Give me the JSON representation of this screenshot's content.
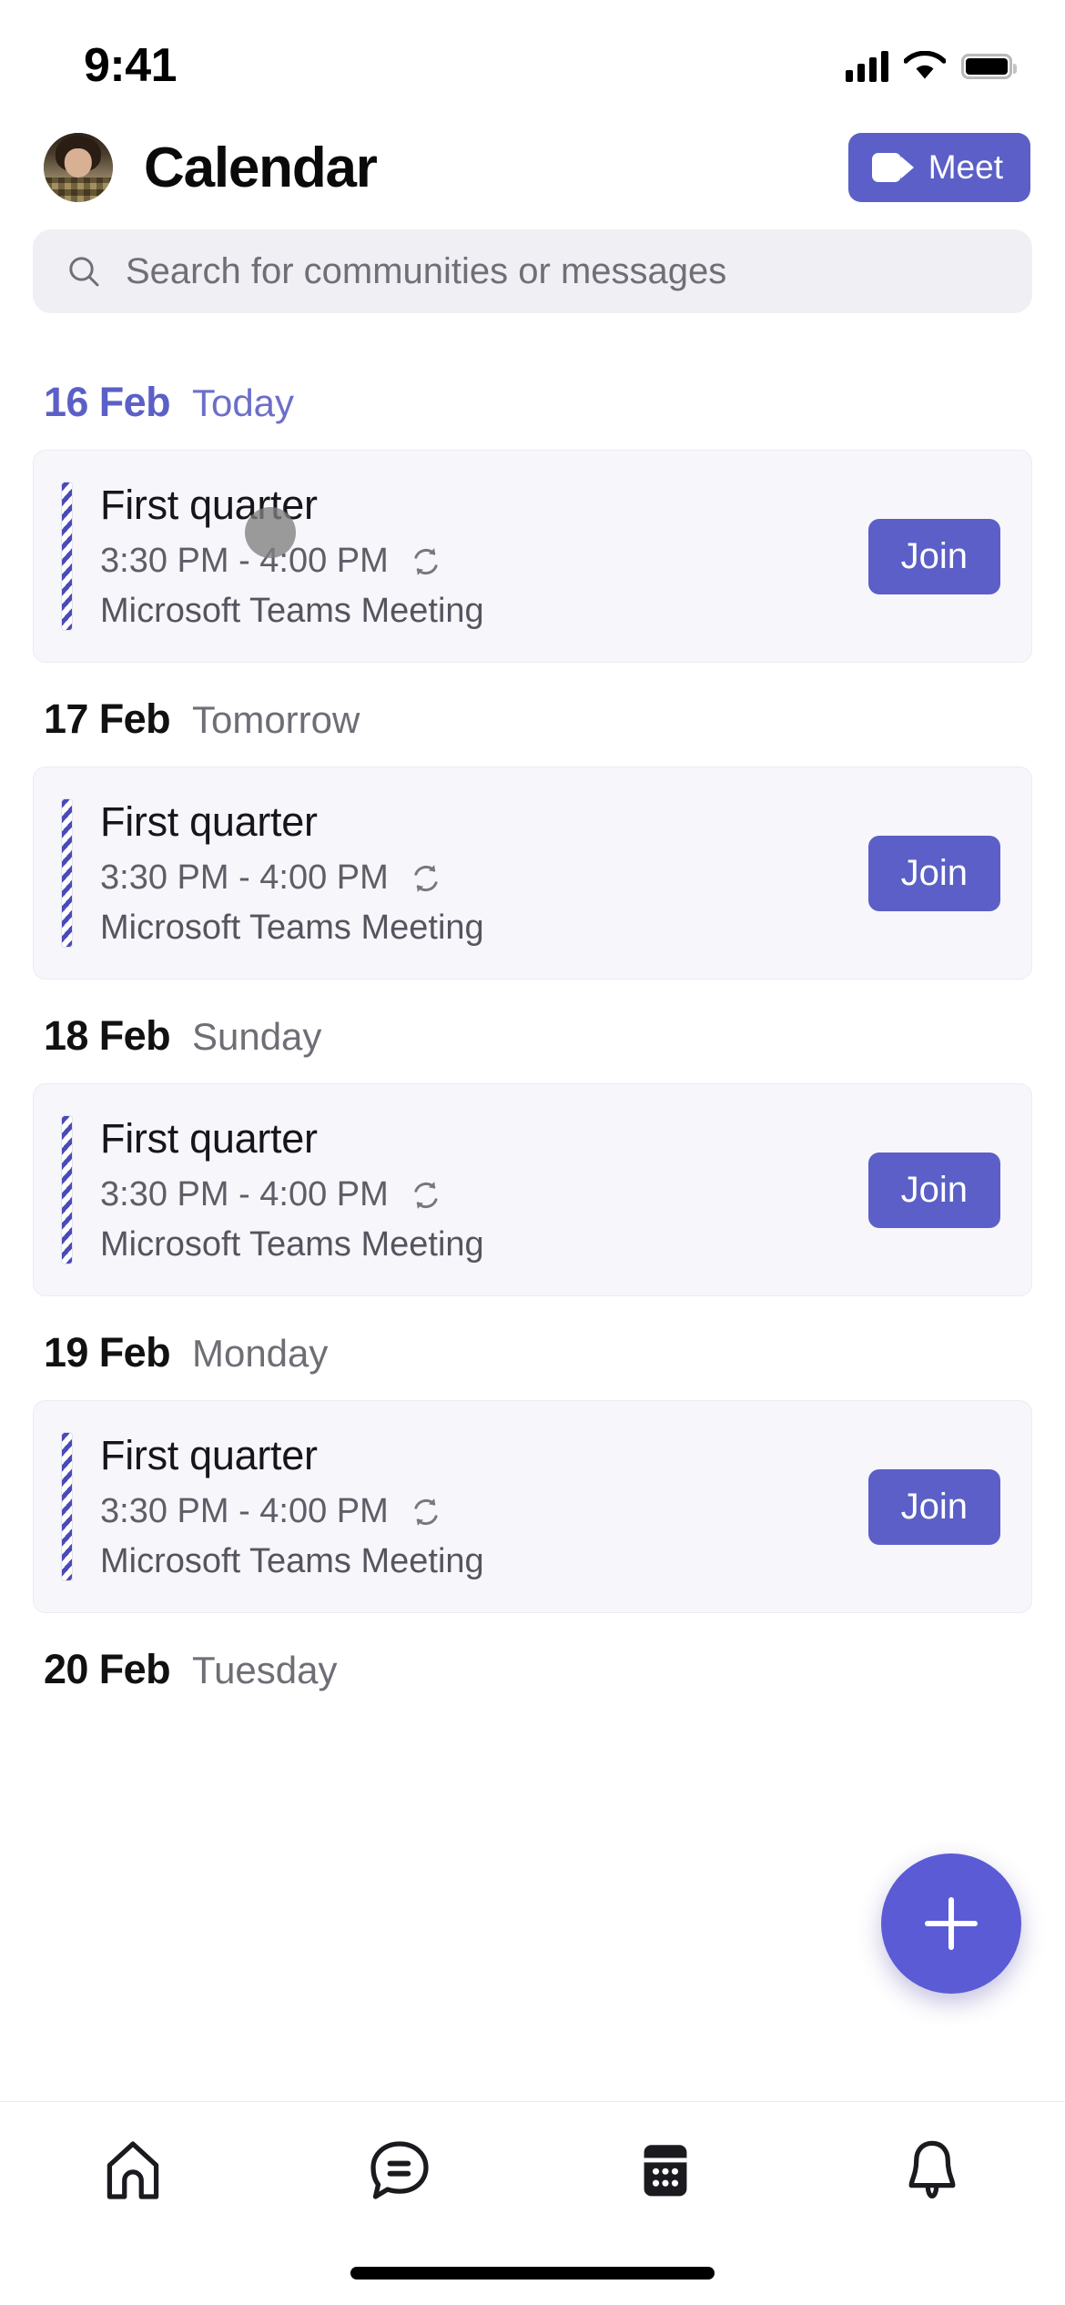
{
  "status_bar": {
    "time": "9:41",
    "signal_icon": "cellular-signal-icon",
    "wifi_icon": "wifi-icon",
    "battery_icon": "battery-icon"
  },
  "header": {
    "avatar_name": "user-avatar",
    "title": "Calendar",
    "meet_button": {
      "label": "Meet",
      "icon": "video-camera-icon",
      "color": "#5B5FC7"
    }
  },
  "search": {
    "placeholder": "Search for communities or messages",
    "value": "",
    "icon": "search-icon",
    "background": "#F0EFF4"
  },
  "theme": {
    "accent": "#5B5FC7",
    "fab": "#5B5BD6",
    "card_bg": "#F7F6FA",
    "today_text": "#5B5FC7",
    "muted_text": "#6E6E76"
  },
  "agenda": {
    "days": [
      {
        "date": "16 Feb",
        "label": "Today",
        "is_today": true,
        "events": [
          {
            "title": "First quarter",
            "time": "3:30 PM - 4:00 PM",
            "recurring_icon": "recurrence-icon",
            "subtitle": "Microsoft Teams Meeting",
            "action_label": "Join",
            "has_touch_indicator": true
          }
        ]
      },
      {
        "date": "17 Feb",
        "label": "Tomorrow",
        "is_today": false,
        "events": [
          {
            "title": "First quarter",
            "time": "3:30 PM - 4:00 PM",
            "recurring_icon": "recurrence-icon",
            "subtitle": "Microsoft Teams Meeting",
            "action_label": "Join",
            "has_touch_indicator": false
          }
        ]
      },
      {
        "date": "18 Feb",
        "label": "Sunday",
        "is_today": false,
        "events": [
          {
            "title": "First quarter",
            "time": "3:30 PM - 4:00 PM",
            "recurring_icon": "recurrence-icon",
            "subtitle": "Microsoft Teams Meeting",
            "action_label": "Join",
            "has_touch_indicator": false
          }
        ]
      },
      {
        "date": "19 Feb",
        "label": "Monday",
        "is_today": false,
        "events": [
          {
            "title": "First quarter",
            "time": "3:30 PM - 4:00 PM",
            "recurring_icon": "recurrence-icon",
            "subtitle": "Microsoft Teams Meeting",
            "action_label": "Join",
            "has_touch_indicator": false
          }
        ]
      },
      {
        "date": "20 Feb",
        "label": "Tuesday",
        "is_today": false,
        "events": []
      }
    ]
  },
  "fab": {
    "icon": "plus-icon",
    "label": "",
    "color": "#5B5BD6"
  },
  "tabbar": {
    "items": [
      {
        "icon": "home-icon",
        "label": "",
        "active": false
      },
      {
        "icon": "chat-icon",
        "label": "",
        "active": false
      },
      {
        "icon": "calendar-icon",
        "label": "",
        "active": true
      },
      {
        "icon": "bell-icon",
        "label": "",
        "active": false
      }
    ]
  }
}
